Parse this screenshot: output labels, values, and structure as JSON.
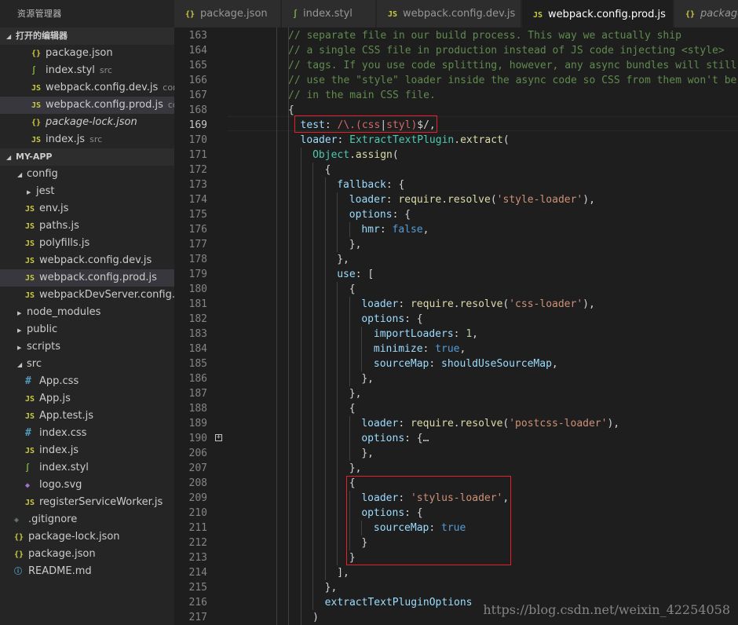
{
  "sidebar": {
    "title": "资源管理器",
    "open_editors": {
      "header": "打开的编辑器",
      "items": [
        {
          "icon": "{}",
          "kind": "json",
          "label": "package.json",
          "desc": ""
        },
        {
          "icon": "∫",
          "kind": "styl",
          "label": "index.styl",
          "desc": "src"
        },
        {
          "icon": "JS",
          "kind": "js",
          "label": "webpack.config.dev.js",
          "desc": "config"
        },
        {
          "icon": "JS",
          "kind": "js",
          "label": "webpack.config.prod.js",
          "desc": "con..."
        },
        {
          "icon": "{}",
          "kind": "json",
          "label": "package-lock.json",
          "desc": ""
        },
        {
          "icon": "JS",
          "kind": "js",
          "label": "index.js",
          "desc": "src"
        }
      ]
    },
    "project": {
      "header": "MY-APP",
      "items": [
        {
          "label": "config",
          "type": "folder-open",
          "depth": 1
        },
        {
          "label": "jest",
          "type": "folder",
          "depth": 2
        },
        {
          "label": "env.js",
          "type": "js",
          "depth": 2
        },
        {
          "label": "paths.js",
          "type": "js",
          "depth": 2
        },
        {
          "label": "polyfills.js",
          "type": "js",
          "depth": 2
        },
        {
          "label": "webpack.config.dev.js",
          "type": "js",
          "depth": 2
        },
        {
          "label": "webpack.config.prod.js",
          "type": "js",
          "depth": 2
        },
        {
          "label": "webpackDevServer.config.js",
          "type": "js",
          "depth": 2
        },
        {
          "label": "node_modules",
          "type": "folder",
          "depth": 1
        },
        {
          "label": "public",
          "type": "folder",
          "depth": 1
        },
        {
          "label": "scripts",
          "type": "folder",
          "depth": 1
        },
        {
          "label": "src",
          "type": "folder-open",
          "depth": 1
        },
        {
          "label": "App.css",
          "type": "css",
          "depth": 2
        },
        {
          "label": "App.js",
          "type": "js",
          "depth": 2
        },
        {
          "label": "App.test.js",
          "type": "js",
          "depth": 2
        },
        {
          "label": "index.css",
          "type": "css",
          "depth": 2
        },
        {
          "label": "index.js",
          "type": "js",
          "depth": 2
        },
        {
          "label": "index.styl",
          "type": "styl",
          "depth": 2
        },
        {
          "label": "logo.svg",
          "type": "svg",
          "depth": 2
        },
        {
          "label": "registerServiceWorker.js",
          "type": "js",
          "depth": 2
        },
        {
          "label": ".gitignore",
          "type": "git",
          "depth": 1
        },
        {
          "label": "package-lock.json",
          "type": "json",
          "depth": 1
        },
        {
          "label": "package.json",
          "type": "json",
          "depth": 1
        },
        {
          "label": "README.md",
          "type": "info",
          "depth": 1
        }
      ]
    }
  },
  "tabs": [
    {
      "icon": "{}",
      "kind": "json",
      "label": "package.json"
    },
    {
      "icon": "∫",
      "kind": "styl",
      "label": "index.styl"
    },
    {
      "icon": "JS",
      "kind": "js",
      "label": "webpack.config.dev.js"
    },
    {
      "icon": "JS",
      "kind": "js",
      "label": "webpack.config.prod.js",
      "close": "✕"
    },
    {
      "icon": "{}",
      "kind": "json",
      "label": "package-lock.json"
    }
  ],
  "editor": {
    "lines": [
      {
        "n": "163",
        "t": [
          [
            "c-cm",
            "// separate file in our build process. This way we actually ship"
          ]
        ]
      },
      {
        "n": "164",
        "t": [
          [
            "c-cm",
            "// a single CSS file in production instead of JS code injecting <style>"
          ]
        ]
      },
      {
        "n": "165",
        "t": [
          [
            "c-cm",
            "// tags. If you use code splitting, however, any async bundles will still"
          ]
        ]
      },
      {
        "n": "166",
        "t": [
          [
            "c-cm",
            "// use the \"style\" loader inside the async code so CSS from them won't be"
          ]
        ]
      },
      {
        "n": "167",
        "t": [
          [
            "c-cm",
            "// in the main CSS file."
          ]
        ]
      },
      {
        "n": "168",
        "t": [
          [
            "c-pl",
            "{"
          ]
        ]
      },
      {
        "n": "169",
        "t": [
          [
            "c-pr",
            "test"
          ],
          [
            "c-pl",
            ": "
          ],
          [
            "c-rx",
            "/\\.("
          ],
          [
            "c-rx",
            "css"
          ],
          [
            "c-pl",
            "|"
          ],
          [
            "c-rx",
            "styl"
          ],
          [
            "c-rx",
            ")"
          ],
          [
            "c-pl",
            "$/,"
          ]
        ]
      },
      {
        "n": "170",
        "t": [
          [
            "c-pr",
            "loader"
          ],
          [
            "c-pl",
            ": "
          ],
          [
            "c-cl",
            "ExtractTextPlugin"
          ],
          [
            "c-pl",
            "."
          ],
          [
            "c-fn",
            "extract"
          ],
          [
            "c-pl",
            "("
          ]
        ]
      },
      {
        "n": "171",
        "t": [
          [
            "c-cl",
            "Object"
          ],
          [
            "c-pl",
            "."
          ],
          [
            "c-fn",
            "assign"
          ],
          [
            "c-pl",
            "("
          ]
        ]
      },
      {
        "n": "172",
        "t": [
          [
            "c-pl",
            "{"
          ]
        ]
      },
      {
        "n": "173",
        "t": [
          [
            "c-pr",
            "fallback"
          ],
          [
            "c-pl",
            ": {"
          ]
        ]
      },
      {
        "n": "174",
        "t": [
          [
            "c-pr",
            "loader"
          ],
          [
            "c-pl",
            ": "
          ],
          [
            "c-fn",
            "require"
          ],
          [
            "c-pl",
            "."
          ],
          [
            "c-fn",
            "resolve"
          ],
          [
            "c-pl",
            "("
          ],
          [
            "c-st",
            "'style-loader'"
          ],
          [
            "c-pl",
            "),"
          ]
        ]
      },
      {
        "n": "175",
        "t": [
          [
            "c-pr",
            "options"
          ],
          [
            "c-pl",
            ": {"
          ]
        ]
      },
      {
        "n": "176",
        "t": [
          [
            "c-pr",
            "hmr"
          ],
          [
            "c-pl",
            ": "
          ],
          [
            "c-kw",
            "false"
          ],
          [
            "c-pl",
            ","
          ]
        ]
      },
      {
        "n": "177",
        "t": [
          [
            "c-pl",
            "},"
          ]
        ]
      },
      {
        "n": "178",
        "t": [
          [
            "c-pl",
            "},"
          ]
        ]
      },
      {
        "n": "179",
        "t": [
          [
            "c-pr",
            "use"
          ],
          [
            "c-pl",
            ": ["
          ]
        ]
      },
      {
        "n": "180",
        "t": [
          [
            "c-pl",
            "{"
          ]
        ]
      },
      {
        "n": "181",
        "t": [
          [
            "c-pr",
            "loader"
          ],
          [
            "c-pl",
            ": "
          ],
          [
            "c-fn",
            "require"
          ],
          [
            "c-pl",
            "."
          ],
          [
            "c-fn",
            "resolve"
          ],
          [
            "c-pl",
            "("
          ],
          [
            "c-st",
            "'css-loader'"
          ],
          [
            "c-pl",
            "),"
          ]
        ]
      },
      {
        "n": "182",
        "t": [
          [
            "c-pr",
            "options"
          ],
          [
            "c-pl",
            ": {"
          ]
        ]
      },
      {
        "n": "183",
        "t": [
          [
            "c-pr",
            "importLoaders"
          ],
          [
            "c-pl",
            ": "
          ],
          [
            "c-nm",
            "1"
          ],
          [
            "c-pl",
            ","
          ]
        ]
      },
      {
        "n": "184",
        "t": [
          [
            "c-pr",
            "minimize"
          ],
          [
            "c-pl",
            ": "
          ],
          [
            "c-kw",
            "true"
          ],
          [
            "c-pl",
            ","
          ]
        ]
      },
      {
        "n": "185",
        "t": [
          [
            "c-pr",
            "sourceMap"
          ],
          [
            "c-pl",
            ": "
          ],
          [
            "c-pr",
            "shouldUseSourceMap"
          ],
          [
            "c-pl",
            ","
          ]
        ]
      },
      {
        "n": "186",
        "t": [
          [
            "c-pl",
            "},"
          ]
        ]
      },
      {
        "n": "187",
        "t": [
          [
            "c-pl",
            "},"
          ]
        ]
      },
      {
        "n": "188",
        "t": [
          [
            "c-pl",
            "{"
          ]
        ]
      },
      {
        "n": "189",
        "t": [
          [
            "c-pr",
            "loader"
          ],
          [
            "c-pl",
            ": "
          ],
          [
            "c-fn",
            "require"
          ],
          [
            "c-pl",
            "."
          ],
          [
            "c-fn",
            "resolve"
          ],
          [
            "c-pl",
            "("
          ],
          [
            "c-st",
            "'postcss-loader'"
          ],
          [
            "c-pl",
            "),"
          ]
        ]
      },
      {
        "n": "190",
        "t": [
          [
            "c-pr",
            "options"
          ],
          [
            "c-pl",
            ": {"
          ],
          [
            "c-pl",
            "…"
          ]
        ],
        "fold": "+"
      },
      {
        "n": "206",
        "t": [
          [
            "c-pl",
            "},"
          ]
        ]
      },
      {
        "n": "207",
        "t": [
          [
            "c-pl",
            "},"
          ]
        ]
      },
      {
        "n": "208",
        "t": [
          [
            "c-pl",
            "{"
          ]
        ]
      },
      {
        "n": "209",
        "t": [
          [
            "c-pr",
            "loader"
          ],
          [
            "c-pl",
            ": "
          ],
          [
            "c-st",
            "'stylus-loader'"
          ],
          [
            "c-pl",
            ","
          ]
        ]
      },
      {
        "n": "210",
        "t": [
          [
            "c-pr",
            "options"
          ],
          [
            "c-pl",
            ": {"
          ]
        ]
      },
      {
        "n": "211",
        "t": [
          [
            "c-pr",
            "sourceMap"
          ],
          [
            "c-pl",
            ": "
          ],
          [
            "c-kw",
            "true"
          ]
        ]
      },
      {
        "n": "212",
        "t": [
          [
            "c-pl",
            "}"
          ]
        ]
      },
      {
        "n": "213",
        "t": [
          [
            "c-pl",
            "}"
          ]
        ]
      },
      {
        "n": "214",
        "t": [
          [
            "c-pl",
            "],"
          ]
        ]
      },
      {
        "n": "215",
        "t": [
          [
            "c-pl",
            "},"
          ]
        ]
      },
      {
        "n": "216",
        "t": [
          [
            "c-pr",
            "extractTextPluginOptions"
          ]
        ]
      },
      {
        "n": "217",
        "t": [
          [
            "c-pl",
            ")"
          ]
        ]
      }
    ],
    "current_line": "169"
  },
  "watermark": "https://blog.csdn.net/weixin_42254058"
}
